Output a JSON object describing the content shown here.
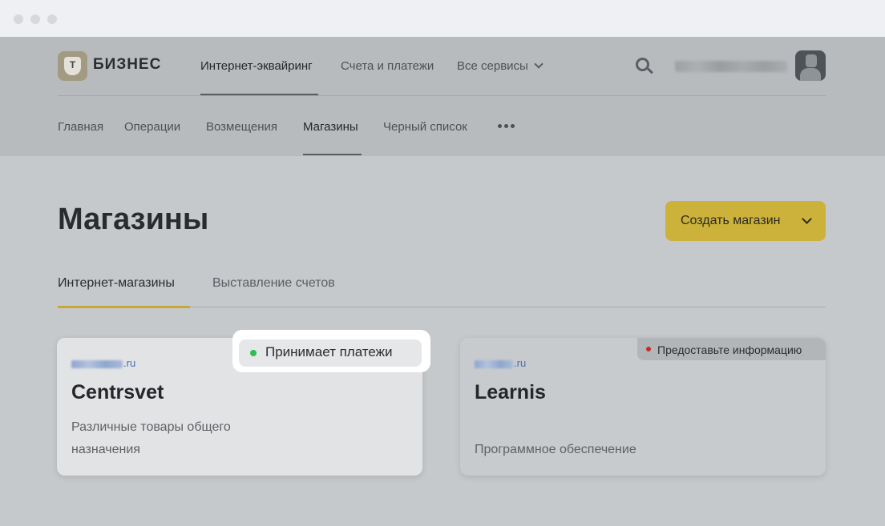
{
  "window": {
    "controls": [
      "close",
      "minimize",
      "maximize"
    ]
  },
  "header": {
    "logo_mark": "Т",
    "logo_text": "БИЗНЕС",
    "nav": [
      {
        "label": "Интернет-эквайринг",
        "active": true
      },
      {
        "label": "Счета и платежи",
        "active": false
      },
      {
        "label": "Все сервисы",
        "active": false
      }
    ],
    "search_icon": "search-icon",
    "user_icon": "avatar"
  },
  "subnav": {
    "items": [
      {
        "label": "Главная"
      },
      {
        "label": "Операции"
      },
      {
        "label": "Возмещения"
      },
      {
        "label": "Магазины",
        "active": true
      },
      {
        "label": "Черный список"
      }
    ],
    "more_icon": "more-horizontal-icon"
  },
  "page": {
    "title": "Магазины",
    "create_button": "Создать магазин"
  },
  "tabs": [
    {
      "label": "Интернет-магазины",
      "active": true
    },
    {
      "label": "Выставление счетов",
      "active": false
    }
  ],
  "shops": [
    {
      "domain_suffix": ".ru",
      "name": "Centrsvet",
      "description": "Различные товары общего назначения",
      "status": "Принимает платежи",
      "status_color": "#2fbe4f"
    },
    {
      "domain_suffix": ".ru",
      "name": "Learnis",
      "description": "Программное обеспечение",
      "status": "Предоставьте информацию",
      "status_color": "#c62a2a"
    }
  ],
  "colors": {
    "accent": "#ccb23a",
    "tab_underline": "#c4a93a",
    "link": "#4a6fb0"
  }
}
